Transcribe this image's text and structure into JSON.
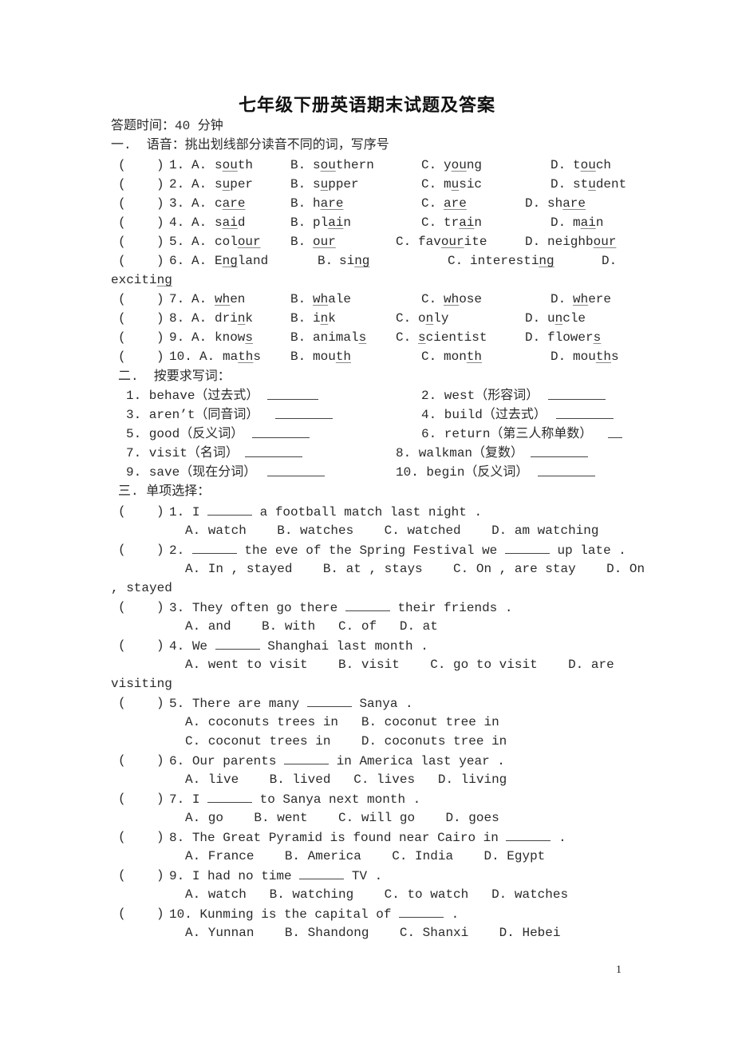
{
  "title": "七年级下册英语期末试题及答案",
  "time_note": "答题时间：40 分钟",
  "section1": {
    "heading": "一.  语音：挑出划线部分读音不同的词，写序号",
    "questions": [
      {
        "num": "1.",
        "A": [
          "s",
          "ou",
          "th"
        ],
        "B": [
          "s",
          "ou",
          "thern"
        ],
        "C": [
          "y",
          "ou",
          "ng"
        ],
        "D": [
          "t",
          "ou",
          "ch"
        ]
      },
      {
        "num": "2.",
        "A": [
          "s",
          "u",
          "per"
        ],
        "B": [
          "s",
          "u",
          "pper"
        ],
        "C": [
          "m",
          "u",
          "sic"
        ],
        "D": [
          "st",
          "u",
          "dent"
        ]
      },
      {
        "num": "3.",
        "A": [
          "c",
          "are",
          ""
        ],
        "B": [
          "h",
          "are",
          ""
        ],
        "C": [
          "",
          "are",
          ""
        ],
        "D": [
          "sh",
          "are",
          ""
        ]
      },
      {
        "num": "4.",
        "A": [
          "s",
          "ai",
          "d"
        ],
        "B": [
          "pl",
          "ai",
          "n"
        ],
        "C": [
          "tr",
          "ai",
          "n"
        ],
        "D": [
          "m",
          "ai",
          "n"
        ]
      },
      {
        "num": "5.",
        "A": [
          "col",
          "our",
          ""
        ],
        "B": [
          "",
          "our",
          ""
        ],
        "C": [
          "fav",
          "our",
          "ite"
        ],
        "D": [
          "neighb",
          "our",
          ""
        ]
      },
      {
        "num": "6.",
        "A": [
          "E",
          "ng",
          "land"
        ],
        "B": [
          "si",
          "ng",
          ""
        ],
        "C": [
          "interesti",
          "ng",
          ""
        ],
        "D": [
          "exciti",
          "ng",
          ""
        ]
      },
      {
        "num": "7.",
        "A": [
          "",
          "wh",
          "en"
        ],
        "B": [
          "",
          "wh",
          "ale"
        ],
        "C": [
          "",
          "wh",
          "ose"
        ],
        "D": [
          "",
          "wh",
          "ere"
        ]
      },
      {
        "num": "8.",
        "A": [
          "dri",
          "n",
          "k"
        ],
        "B": [
          "i",
          "n",
          "k"
        ],
        "C": [
          "o",
          "n",
          "ly"
        ],
        "D": [
          "u",
          "n",
          "cle"
        ]
      },
      {
        "num": "9.",
        "A": [
          "know",
          "s",
          ""
        ],
        "B": [
          "animal",
          "s",
          ""
        ],
        "C": [
          "",
          "s",
          "cientist"
        ],
        "D": [
          "flower",
          "s",
          ""
        ]
      },
      {
        "num": "10.",
        "A": [
          "ma",
          "th",
          "s"
        ],
        "B": [
          "mou",
          "th",
          ""
        ],
        "C": [
          "mon",
          "th",
          ""
        ],
        "D": [
          "mou",
          "th",
          "s"
        ]
      }
    ]
  },
  "section2": {
    "heading": "二.  按要求写词：",
    "items": [
      "1. behave（过去式）",
      "2. west（形容词）",
      "3. aren’t（同音词）",
      "4. build（过去式）",
      "5. good（反义词）",
      "6. return（第三人称单数）",
      "7. visit（名词）",
      "8. walkman（复数）",
      "9. save（现在分词）",
      "10. begin（反义词）"
    ]
  },
  "section3": {
    "heading": "三. 单项选择：",
    "questions": [
      {
        "num": "1.",
        "pre": "I ",
        "post": " a football match last night .",
        "options": "A. watch    B. watches    C. watched    D. am watching"
      },
      {
        "num": "2.",
        "pre": "",
        "post": " the eve of the Spring Festival we ",
        "post2": " up late .",
        "options": "A. In , stayed    B. at , stays    C. On , are stay    D. On",
        "options_wrap": ", stayed"
      },
      {
        "num": "3.",
        "pre": "They often go there ",
        "post": " their friends .",
        "options": "A. and    B. with   C. of   D. at"
      },
      {
        "num": "4.",
        "pre": "We ",
        "post": " Shanghai last month .",
        "options": "A. went to visit    B. visit    C. go to visit    D. are",
        "options_wrap": "visiting"
      },
      {
        "num": "5.",
        "pre": "There are many ",
        "post": " Sanya .",
        "options": "A. coconuts trees in   B. coconut tree in",
        "options2": "C. coconut trees in    D. coconuts tree in"
      },
      {
        "num": "6.",
        "pre": "Our parents ",
        "post": " in America last year .",
        "options": "A. live    B. lived   C. lives   D. living"
      },
      {
        "num": "7.",
        "pre": "I ",
        "post": " to Sanya next month .",
        "options": "A. go    B. went    C. will go    D. goes"
      },
      {
        "num": "8.",
        "pre": "The Great Pyramid is found near Cairo in ",
        "post": " .",
        "options": "A. France    B. America    C. India    D. Egypt"
      },
      {
        "num": "9.",
        "pre": "I had no time ",
        "post": " TV .",
        "options": "A. watch   B. watching    C. to watch   D. watches"
      },
      {
        "num": "10.",
        "pre": "Kunming is the capital of ",
        "post": " .",
        "options": "A. Yunnan    B. Shandong    C. Shanxi    D. Hebei"
      }
    ]
  },
  "paren_open": "(",
  "paren_close": ")",
  "page_number": "1"
}
